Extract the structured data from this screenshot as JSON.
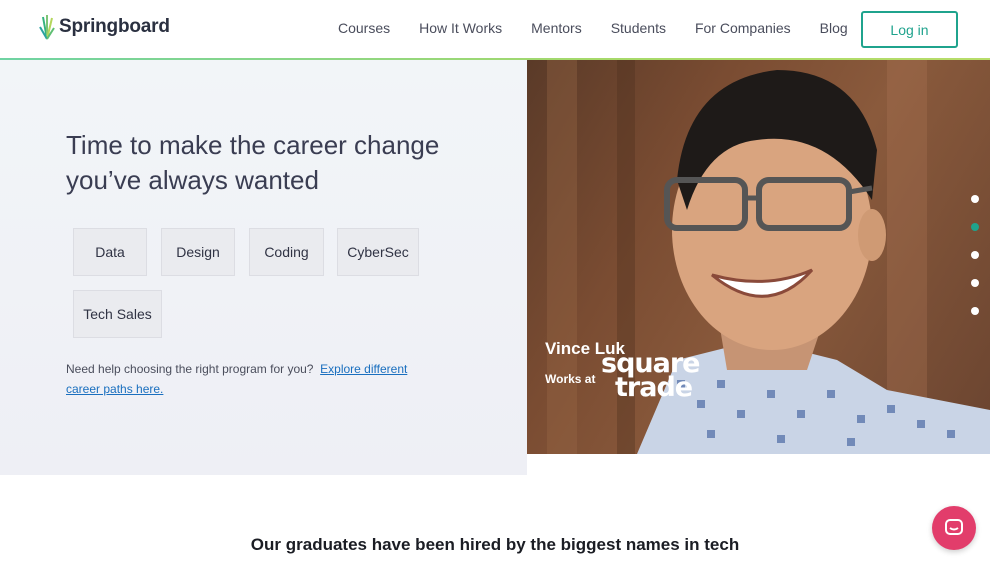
{
  "header": {
    "brand": "Springboard",
    "nav": [
      "Courses",
      "How It Works",
      "Mentors",
      "Students",
      "For Companies",
      "Blog"
    ],
    "login_label": "Log in"
  },
  "hero": {
    "title": "Time to make the career change you’ve always wanted",
    "chips": [
      "Data",
      "Design",
      "Coding",
      "CyberSec",
      "Tech Sales"
    ],
    "help_text": "Need help choosing the right program for you?",
    "help_link": "Explore different career paths here."
  },
  "testimonial": {
    "name": "Vince Luk",
    "works_at": "Works at",
    "company_line1": "square",
    "company_line2": "trade",
    "slides": 5,
    "active_slide": 2
  },
  "section": {
    "title": "Our graduates have been hired by the biggest names in tech"
  },
  "colors": {
    "accent": "#1fa38d",
    "chat": "#e23d6b",
    "link": "#1a6fbf"
  },
  "icons": {
    "logo": "springboard-leaf-icon",
    "chat": "chat-bubble-icon"
  }
}
